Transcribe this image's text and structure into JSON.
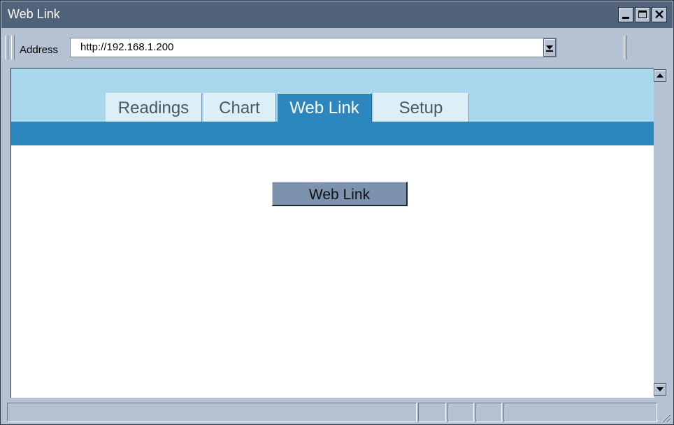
{
  "window": {
    "title": "Web Link"
  },
  "window_controls": {
    "close_glyph": "✕"
  },
  "address": {
    "label": "Address",
    "value": "http://192.168.1.200"
  },
  "tabs": [
    {
      "label": "Readings",
      "active": false
    },
    {
      "label": "Chart",
      "active": false
    },
    {
      "label": "Web Link",
      "active": true
    },
    {
      "label": "Setup",
      "active": false
    }
  ],
  "content": {
    "button_label": "Web Link"
  },
  "colors": {
    "titlebar": "#50637b",
    "chrome": "#b4c2d3",
    "header_light": "#a9d8ec",
    "header_dark": "#2b87bd",
    "button": "#7d92ad"
  },
  "icons": [
    "minimize-icon",
    "maximize-icon",
    "close-icon",
    "dropdown-arrow-icon",
    "scroll-up-icon",
    "scroll-down-icon",
    "resize-grip-icon"
  ]
}
